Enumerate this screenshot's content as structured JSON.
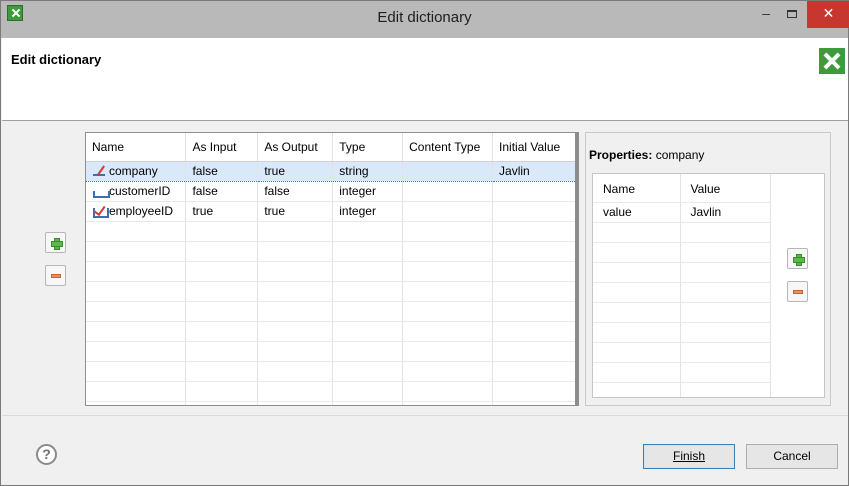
{
  "window": {
    "title": "Edit dictionary",
    "min_symbol": "–",
    "close_symbol": "✕"
  },
  "header": {
    "title": "Edit dictionary"
  },
  "main_table": {
    "columns": [
      "Name",
      "As Input",
      "As Output",
      "Type",
      "Content Type",
      "Initial Value"
    ],
    "rows": [
      {
        "name": "company",
        "icon": "string-field-icon",
        "as_input": "false",
        "as_output": "true",
        "type": "string",
        "content_type": "",
        "initial_value": "Javlin",
        "selected": true
      },
      {
        "name": "customerID",
        "icon": "integer-field-icon",
        "as_input": "false",
        "as_output": "false",
        "type": "integer",
        "content_type": "",
        "initial_value": ""
      },
      {
        "name": "employeeID",
        "icon": "checkbox-field-icon",
        "as_input": "true",
        "as_output": "true",
        "type": "integer",
        "content_type": "",
        "initial_value": ""
      }
    ]
  },
  "properties": {
    "label": "Properties:",
    "entry": "company",
    "columns": [
      "Name",
      "Value"
    ],
    "rows": [
      {
        "name": "value",
        "value": "Javlin"
      }
    ]
  },
  "buttons": {
    "finish": "Finish",
    "cancel": "Cancel",
    "help": "?"
  },
  "colors": {
    "selection": "#d9e9f9",
    "close_button": "#c7372f",
    "accent_green": "#3e9a3a"
  }
}
